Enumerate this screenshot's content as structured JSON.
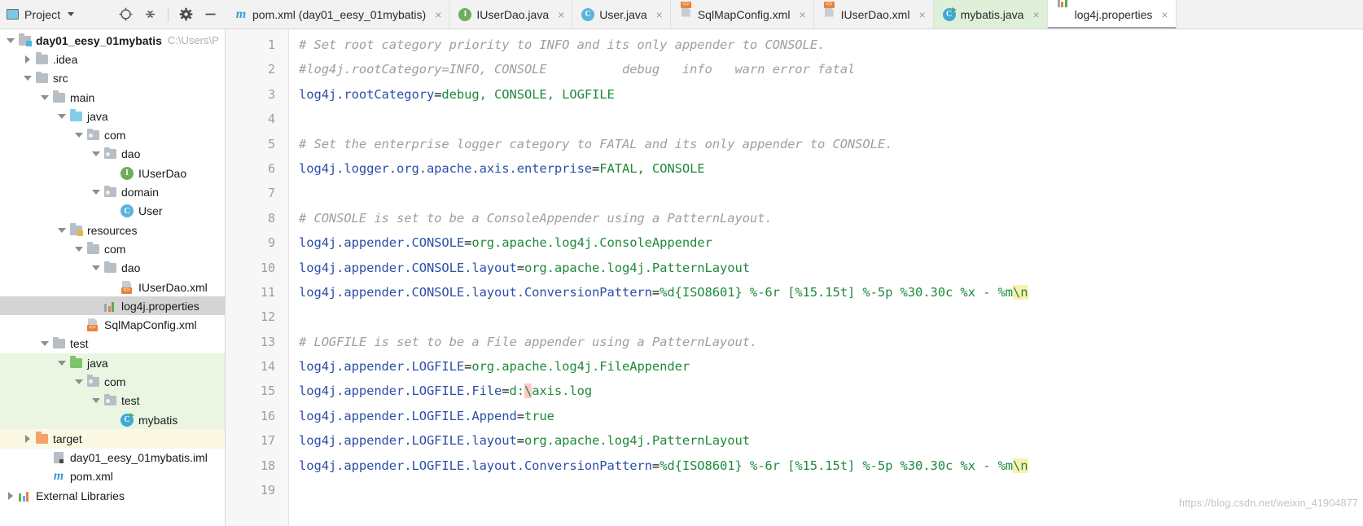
{
  "tool_window": {
    "title": "Project",
    "icons": [
      "project-view-icon",
      "dropdown-caret",
      "locate-icon",
      "collapse-all-icon",
      "settings-gear-icon",
      "hide-icon"
    ]
  },
  "tabs": [
    {
      "label": "pom.xml (day01_eesy_01mybatis)",
      "icon": "maven-m-icon",
      "state": "normal",
      "close": "×"
    },
    {
      "label": "IUserDao.java",
      "icon": "interface-icon",
      "state": "normal",
      "close": "×"
    },
    {
      "label": "User.java",
      "icon": "class-icon",
      "state": "normal",
      "close": "×"
    },
    {
      "label": "SqlMapConfig.xml",
      "icon": "xml-file-icon",
      "state": "normal",
      "close": "×"
    },
    {
      "label": "IUserDao.xml",
      "icon": "xml-file-icon",
      "state": "normal",
      "close": "×"
    },
    {
      "label": "mybatis.java",
      "icon": "runnable-class-icon",
      "state": "green",
      "close": "×"
    },
    {
      "label": "log4j.properties",
      "icon": "properties-file-icon",
      "state": "active",
      "close": "×"
    }
  ],
  "tree": [
    {
      "label": "day01_eesy_01mybatis",
      "path": "C:\\Users\\P",
      "indent": 0,
      "twisty": "down",
      "icon": "module-folder-icon",
      "bold": true,
      "tint": ""
    },
    {
      "label": ".idea",
      "path": "",
      "indent": 1,
      "twisty": "right",
      "icon": "folder-icon",
      "bold": false,
      "tint": ""
    },
    {
      "label": "src",
      "path": "",
      "indent": 1,
      "twisty": "down",
      "icon": "folder-icon",
      "bold": false,
      "tint": ""
    },
    {
      "label": "main",
      "path": "",
      "indent": 2,
      "twisty": "down",
      "icon": "folder-icon",
      "bold": false,
      "tint": ""
    },
    {
      "label": "java",
      "path": "",
      "indent": 3,
      "twisty": "down",
      "icon": "source-root-folder-icon",
      "bold": false,
      "tint": ""
    },
    {
      "label": "com",
      "path": "",
      "indent": 4,
      "twisty": "down",
      "icon": "package-folder-icon",
      "bold": false,
      "tint": ""
    },
    {
      "label": "dao",
      "path": "",
      "indent": 5,
      "twisty": "down",
      "icon": "package-folder-icon",
      "bold": false,
      "tint": ""
    },
    {
      "label": "IUserDao",
      "path": "",
      "indent": 6,
      "twisty": "none",
      "icon": "interface-icon",
      "bold": false,
      "tint": ""
    },
    {
      "label": "domain",
      "path": "",
      "indent": 5,
      "twisty": "down",
      "icon": "package-folder-icon",
      "bold": false,
      "tint": ""
    },
    {
      "label": "User",
      "path": "",
      "indent": 6,
      "twisty": "none",
      "icon": "class-icon",
      "bold": false,
      "tint": ""
    },
    {
      "label": "resources",
      "path": "",
      "indent": 3,
      "twisty": "down",
      "icon": "resources-root-folder-icon",
      "bold": false,
      "tint": ""
    },
    {
      "label": "com",
      "path": "",
      "indent": 4,
      "twisty": "down",
      "icon": "folder-icon",
      "bold": false,
      "tint": ""
    },
    {
      "label": "dao",
      "path": "",
      "indent": 5,
      "twisty": "down",
      "icon": "folder-icon",
      "bold": false,
      "tint": ""
    },
    {
      "label": "IUserDao.xml",
      "path": "",
      "indent": 6,
      "twisty": "none",
      "icon": "xml-file-icon",
      "bold": false,
      "tint": ""
    },
    {
      "label": "log4j.properties",
      "path": "",
      "indent": 5,
      "twisty": "none",
      "icon": "properties-file-icon",
      "bold": false,
      "tint": "selected"
    },
    {
      "label": "SqlMapConfig.xml",
      "path": "",
      "indent": 4,
      "twisty": "none",
      "icon": "xml-file-icon",
      "bold": false,
      "tint": ""
    },
    {
      "label": "test",
      "path": "",
      "indent": 2,
      "twisty": "down",
      "icon": "folder-icon",
      "bold": false,
      "tint": ""
    },
    {
      "label": "java",
      "path": "",
      "indent": 3,
      "twisty": "down",
      "icon": "test-source-root-folder-icon",
      "bold": false,
      "tint": "green"
    },
    {
      "label": "com",
      "path": "",
      "indent": 4,
      "twisty": "down",
      "icon": "package-folder-icon",
      "bold": false,
      "tint": "green"
    },
    {
      "label": "test",
      "path": "",
      "indent": 5,
      "twisty": "down",
      "icon": "package-folder-icon",
      "bold": false,
      "tint": "green"
    },
    {
      "label": "mybatis",
      "path": "",
      "indent": 6,
      "twisty": "none",
      "icon": "runnable-class-icon",
      "bold": false,
      "tint": "green"
    },
    {
      "label": "target",
      "path": "",
      "indent": 1,
      "twisty": "right",
      "icon": "excluded-folder-icon",
      "bold": false,
      "tint": "yellow"
    },
    {
      "label": "day01_eesy_01mybatis.iml",
      "path": "",
      "indent": 2,
      "twisty": "none",
      "icon": "iml-file-icon",
      "bold": false,
      "tint": ""
    },
    {
      "label": "pom.xml",
      "path": "",
      "indent": 2,
      "twisty": "none",
      "icon": "maven-m-icon",
      "bold": false,
      "tint": ""
    },
    {
      "label": "External Libraries",
      "path": "",
      "indent": 0,
      "twisty": "right",
      "icon": "libraries-icon",
      "bold": false,
      "tint": ""
    }
  ],
  "editor": {
    "filename": "log4j.properties",
    "line_numbers": [
      1,
      2,
      3,
      4,
      5,
      6,
      7,
      8,
      9,
      10,
      11,
      12,
      13,
      14,
      15,
      16,
      17,
      18,
      19
    ],
    "lines": [
      {
        "n": 1,
        "segments": [
          {
            "t": "# Set root category priority to INFO and its only appender to CONSOLE.",
            "c": "cmt"
          }
        ]
      },
      {
        "n": 2,
        "segments": [
          {
            "t": "#log4j.rootCategory=INFO, CONSOLE          debug   info   warn error fatal",
            "c": "cmt"
          }
        ]
      },
      {
        "n": 3,
        "segments": [
          {
            "t": "log4j.rootCategory",
            "c": "key"
          },
          {
            "t": "=",
            "c": "eq"
          },
          {
            "t": "debug, CONSOLE, LOGFILE",
            "c": "val"
          }
        ]
      },
      {
        "n": 4,
        "segments": [
          {
            "t": "",
            "c": "eq"
          }
        ]
      },
      {
        "n": 5,
        "segments": [
          {
            "t": "# Set the enterprise logger category to FATAL and its only appender to CONSOLE.",
            "c": "cmt"
          }
        ]
      },
      {
        "n": 6,
        "segments": [
          {
            "t": "log4j.logger.org.apache.axis.enterprise",
            "c": "key"
          },
          {
            "t": "=",
            "c": "eq"
          },
          {
            "t": "FATAL, CONSOLE",
            "c": "val"
          }
        ]
      },
      {
        "n": 7,
        "segments": [
          {
            "t": "",
            "c": "eq"
          }
        ]
      },
      {
        "n": 8,
        "segments": [
          {
            "t": "# CONSOLE is set to be a ConsoleAppender using a PatternLayout.",
            "c": "cmt"
          }
        ]
      },
      {
        "n": 9,
        "segments": [
          {
            "t": "log4j.appender.CONSOLE",
            "c": "key"
          },
          {
            "t": "=",
            "c": "eq"
          },
          {
            "t": "org.apache.log4j.ConsoleAppender",
            "c": "val"
          }
        ]
      },
      {
        "n": 10,
        "segments": [
          {
            "t": "log4j.appender.CONSOLE.layout",
            "c": "key"
          },
          {
            "t": "=",
            "c": "eq"
          },
          {
            "t": "org.apache.log4j.PatternLayout",
            "c": "val"
          }
        ]
      },
      {
        "n": 11,
        "segments": [
          {
            "t": "log4j.appender.CONSOLE.layout.ConversionPattern",
            "c": "key"
          },
          {
            "t": "=",
            "c": "eq"
          },
          {
            "t": "%d{ISO8601} %-6r [%15.15t] %-5p %30.30c %x - %m",
            "c": "val"
          },
          {
            "t": "\\n",
            "c": "val hl-yellow"
          }
        ]
      },
      {
        "n": 12,
        "segments": [
          {
            "t": "",
            "c": "eq"
          }
        ]
      },
      {
        "n": 13,
        "segments": [
          {
            "t": "# LOGFILE is set to be a File appender using a PatternLayout.",
            "c": "cmt"
          }
        ]
      },
      {
        "n": 14,
        "segments": [
          {
            "t": "log4j.appender.LOGFILE",
            "c": "key"
          },
          {
            "t": "=",
            "c": "eq"
          },
          {
            "t": "org.apache.log4j.FileAppender",
            "c": "val"
          }
        ]
      },
      {
        "n": 15,
        "segments": [
          {
            "t": "log4j.appender.LOGFILE.File",
            "c": "key"
          },
          {
            "t": "=",
            "c": "eq"
          },
          {
            "t": "d:",
            "c": "val"
          },
          {
            "t": "\\",
            "c": "val hl-pink"
          },
          {
            "t": "axis.log",
            "c": "val"
          }
        ]
      },
      {
        "n": 16,
        "segments": [
          {
            "t": "log4j.appender.LOGFILE.Append",
            "c": "key"
          },
          {
            "t": "=",
            "c": "eq"
          },
          {
            "t": "true",
            "c": "val"
          }
        ]
      },
      {
        "n": 17,
        "segments": [
          {
            "t": "log4j.appender.LOGFILE.layout",
            "c": "key"
          },
          {
            "t": "=",
            "c": "eq"
          },
          {
            "t": "org.apache.log4j.PatternLayout",
            "c": "val"
          }
        ]
      },
      {
        "n": 18,
        "segments": [
          {
            "t": "log4j.appender.LOGFILE.layout.ConversionPattern",
            "c": "key"
          },
          {
            "t": "=",
            "c": "eq"
          },
          {
            "t": "%d{ISO8601} %-6r [%15.15t] %-5p %30.30c %x - %m",
            "c": "val"
          },
          {
            "t": "\\n",
            "c": "val hl-yellow"
          }
        ]
      },
      {
        "n": 19,
        "segments": [
          {
            "t": "",
            "c": "eq"
          }
        ]
      }
    ],
    "watermark": "https://blog.csdn.net/weixin_41904877"
  },
  "colors": {
    "key": "#2c4fa8",
    "value": "#1f8a3c",
    "comment": "#9aa0a6",
    "selection": "#d4d4d4",
    "test_tint": "#eaf5e2",
    "excluded_tint": "#fbf8e3",
    "highlight_yellow": "#faf0b0",
    "highlight_pink": "#ffc8c8"
  }
}
